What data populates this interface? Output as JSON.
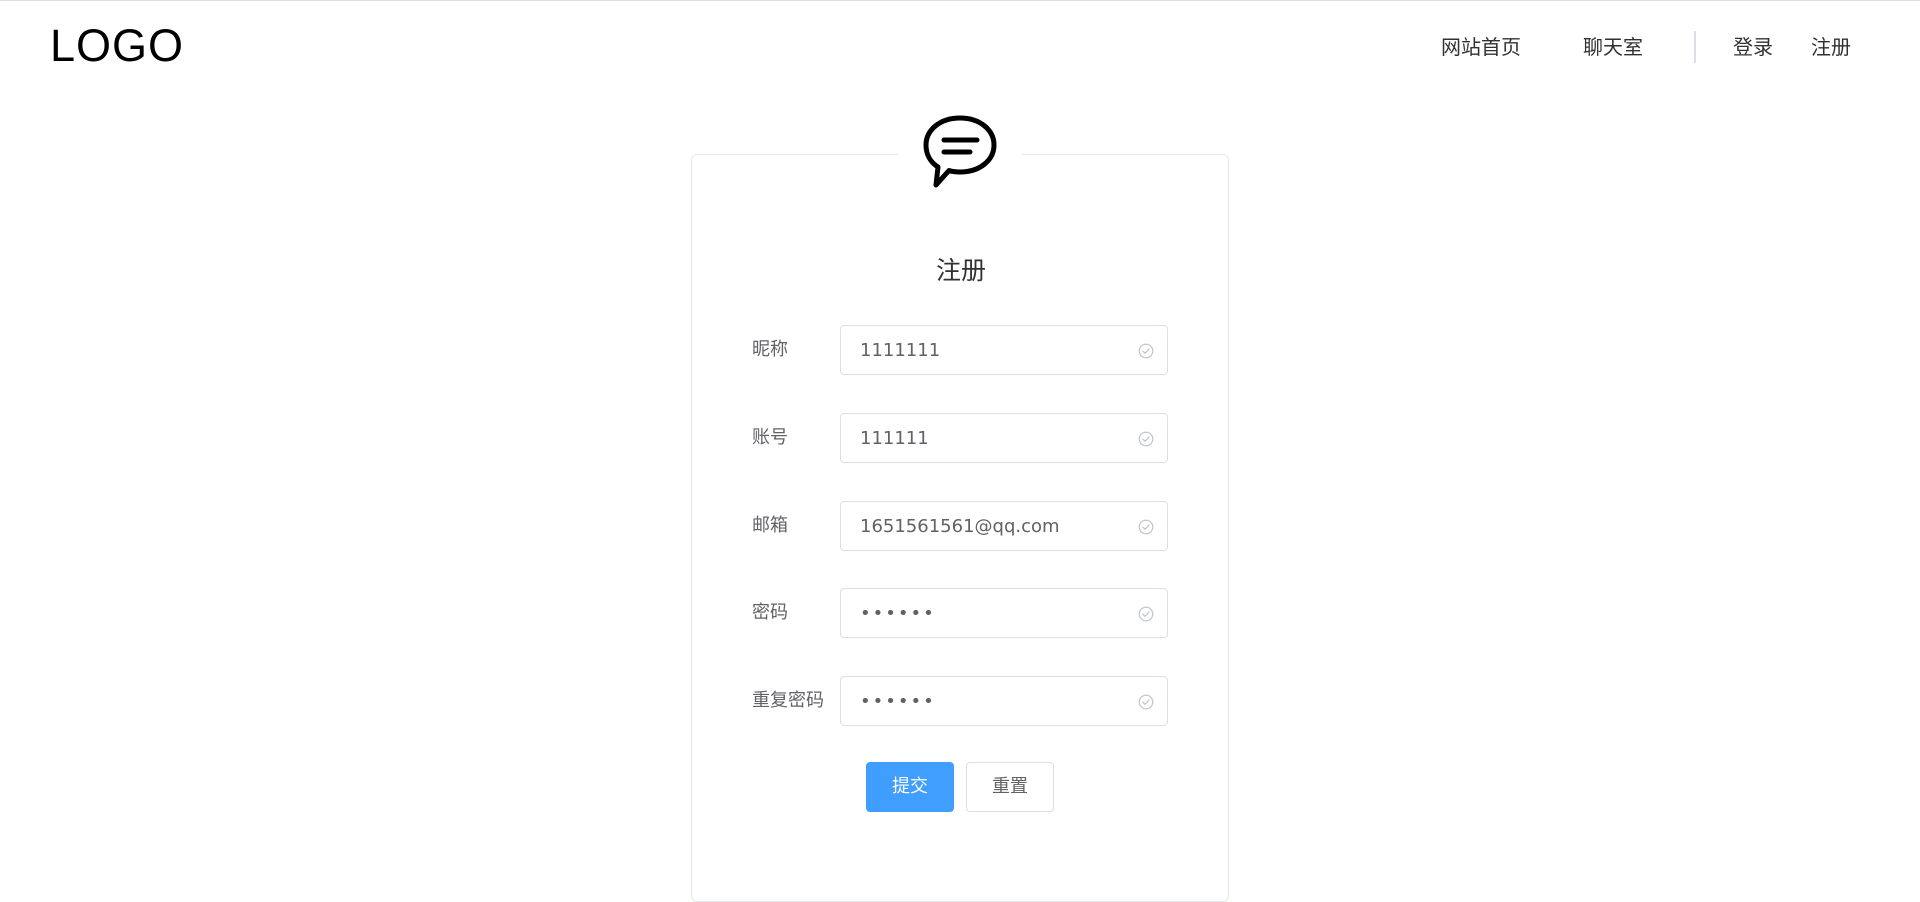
{
  "header": {
    "logo": "LOGO",
    "nav": {
      "home": "网站首页",
      "chatroom": "聊天室",
      "login": "登录",
      "register": "注册"
    }
  },
  "form": {
    "title": "注册",
    "fields": {
      "nickname": {
        "label": "昵称",
        "value": "1111111"
      },
      "account": {
        "label": "账号",
        "value": "111111"
      },
      "email": {
        "label": "邮箱",
        "value": "1651561561@qq.com"
      },
      "password": {
        "label": "密码",
        "value": "••••••"
      },
      "confirm_password": {
        "label": "重复密码",
        "value": "••••••"
      }
    },
    "buttons": {
      "submit": "提交",
      "reset": "重置"
    }
  },
  "icons": {
    "brand": "chat-bubble-icon",
    "field_valid": "circle-check-icon"
  },
  "colors": {
    "primary": "#409eff",
    "valid_icon": "#c0c4cc",
    "border": "#dcdfe6"
  }
}
